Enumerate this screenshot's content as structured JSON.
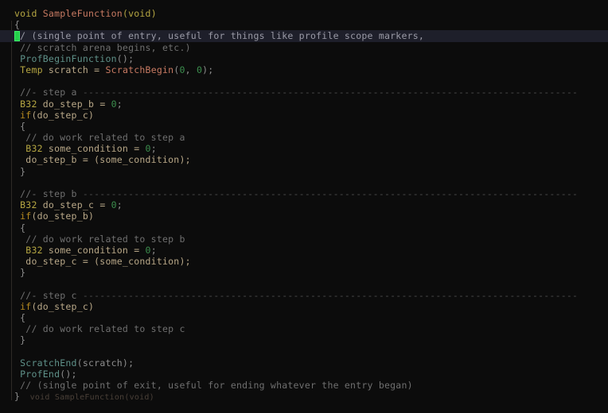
{
  "editor": {
    "theme": {
      "background": "#0c0c0c",
      "current_line_background": "#1e1f2a",
      "cursor": "#24d04a",
      "type_color": "#b5a642",
      "keyword_color": "#b5891f",
      "function_color": "#c87a62",
      "call_color": "#5f9189",
      "identifier_color": "#b9a888",
      "number_color": "#3c8f4e",
      "punct_color": "#8d8d8d",
      "comment_color": "#6f6f6f",
      "separator_color": "#4a4a4a",
      "annotation_color": "#4a4038",
      "indent_guide_color": "#2e2a26"
    },
    "cursor": {
      "line": 3,
      "column": 2
    },
    "closing_annotation": "void SampleFunction(void)",
    "code": {
      "l1_void": "void ",
      "l1_name": "SampleFunction",
      "l1_args": "(void)",
      "l2_brace": "{",
      "l3_comment": "// (single point of entry, useful for things like profile scope markers,",
      "l4_comment": " // scratch arena begins, etc.)",
      "l5_call": " ProfBeginFunction",
      "l5_punct": "();",
      "l6_type": " Temp",
      "l6_mid": " scratch = ",
      "l6_fn": "ScratchBegin",
      "l6_open": "(",
      "l6_num1": "0",
      "l6_comma": ", ",
      "l6_num2": "0",
      "l6_close": ");",
      "l8_sep_label": " //- step a ",
      "l8_sep_rule": "---------------------------------------------------------------------------------------",
      "l9_type": " B32",
      "l9_mid": " do_step_b = ",
      "l9_num": "0",
      "l9_end": ";",
      "l10_kw": " if",
      "l10_rest": "(do_step_c)",
      "l11_brace": " {",
      "l12_comment": "  // do work related to step a",
      "l13_type": "  B32",
      "l13_mid": " some_condition = ",
      "l13_num": "0",
      "l13_end": ";",
      "l14_text": "  do_step_b = (some_condition);",
      "l15_brace": " }",
      "l17_sep_label": " //- step b ",
      "l17_sep_rule": "---------------------------------------------------------------------------------------",
      "l18_type": " B32",
      "l18_mid": " do_step_c = ",
      "l18_num": "0",
      "l18_end": ";",
      "l19_kw": " if",
      "l19_rest": "(do_step_b)",
      "l20_brace": " {",
      "l21_comment": "  // do work related to step b",
      "l22_type": "  B32",
      "l22_mid": " some_condition = ",
      "l22_num": "0",
      "l22_end": ";",
      "l23_text": "  do_step_c = (some_condition);",
      "l24_brace": " }",
      "l26_sep_label": " //- step c ",
      "l26_sep_rule": "---------------------------------------------------------------------------------------",
      "l27_kw": " if",
      "l27_rest": "(do_step_c)",
      "l28_brace": " {",
      "l29_comment": "  // do work related to step c",
      "l30_brace": " }",
      "l32_call": " ScratchEnd",
      "l32_punct": "(scratch);",
      "l33_call": " ProfEnd",
      "l33_punct": "();",
      "l34_comment": " // (single point of exit, useful for ending whatever the entry began)",
      "l35_brace": "}"
    }
  }
}
